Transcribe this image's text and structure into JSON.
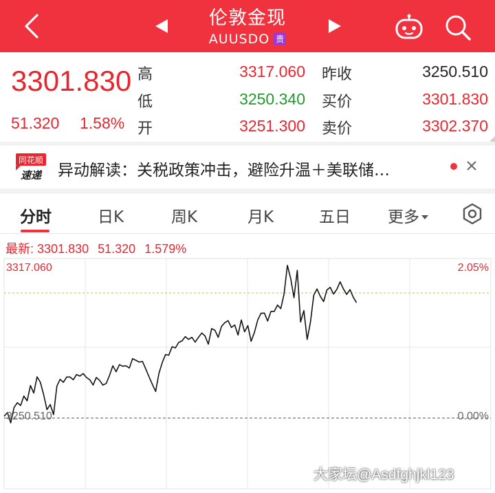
{
  "header": {
    "title": "伦敦金现",
    "subtitle": "AUUSDO",
    "tag": "贵",
    "icons": {
      "back": "back-icon",
      "prev": "triangle-left-icon",
      "next": "triangle-right-icon",
      "assistant": "robot-icon",
      "search": "search-icon"
    }
  },
  "quote": {
    "price": "3301.830",
    "change": "51.320",
    "change_pct": "1.58%",
    "high_label": "高",
    "high": "3317.060",
    "low_label": "低",
    "low": "3250.340",
    "open_label": "开",
    "open": "3251.300",
    "prev_close_label": "昨收",
    "prev_close": "3250.510",
    "bid_label": "买价",
    "bid": "3301.830",
    "ask_label": "卖价",
    "ask": "3302.370"
  },
  "news": {
    "logo_top": "同花顺",
    "logo_bottom": "速递",
    "text": "异动解读：关税政策冲击，避险升温＋美联储…"
  },
  "tabs": [
    {
      "label": "分时",
      "active": true
    },
    {
      "label": "日K"
    },
    {
      "label": "周K"
    },
    {
      "label": "月K"
    },
    {
      "label": "五日"
    },
    {
      "label": "更多"
    }
  ],
  "latest": {
    "label": "最新:",
    "price": "3301.830",
    "change": "51.320",
    "change_pct": "1.579%"
  },
  "colors": {
    "brand_red": "#f0323e",
    "up_red": "#e8262f",
    "down_green": "#1f9a2b",
    "tag_purple": "#9c3ad6"
  },
  "chart_data": {
    "type": "line",
    "ylim": [
      3250.51,
      3317.06
    ],
    "y_tick_labels_left": [
      "3317.060",
      "3250.510"
    ],
    "y_tick_labels_right": [
      "2.05%",
      "0.00%"
    ],
    "reference_line": 3250.51,
    "high_line": 3317.06,
    "series": [
      {
        "values": [
          3251.3,
          3252.9,
          3248.4,
          3255.1,
          3257.2,
          3256.0,
          3260.1,
          3258.0,
          3264.7,
          3261.4,
          3268.5,
          3266.1,
          3260.7,
          3254.2,
          3256.4,
          3252.0,
          3264.4,
          3267.4,
          3266.1,
          3268.4,
          3268.4,
          3267.2,
          3269.5,
          3268.8,
          3269.9,
          3268.2,
          3267.2,
          3264.9,
          3268.2,
          3266.9,
          3264.9,
          3265.6,
          3269.1,
          3273.3,
          3270.7,
          3273.8,
          3273.1,
          3273.3,
          3272.3,
          3276.4,
          3275.7,
          3274.9,
          3275.2,
          3271.9,
          3268.5,
          3265.2,
          3262.1,
          3270.0,
          3274.7,
          3278.2,
          3277.9,
          3281.6,
          3281.1,
          3283.5,
          3284.1,
          3286.0,
          3284.8,
          3285.7,
          3283.6,
          3285.7,
          3287.6,
          3286.3,
          3282.7,
          3289.5,
          3288.8,
          3285.7,
          3290.5,
          3292.1,
          3293.0,
          3290.0,
          3291.1,
          3286.7,
          3293.3,
          3288.1,
          3290.8,
          3284.0,
          3287.9,
          3293.3,
          3296.2,
          3296.3,
          3292.8,
          3297.0,
          3297.0,
          3299.8,
          3298.2,
          3304.6,
          3317.1,
          3311.4,
          3303.0,
          3314.9,
          3292.4,
          3297.4,
          3284.8,
          3292.4,
          3304.1,
          3306.8,
          3303.6,
          3301.3,
          3306.4,
          3307.5,
          3304.6,
          3306.6,
          3309.9,
          3306.8,
          3304.4,
          3306.5,
          3303.2,
          3300.8
        ]
      }
    ]
  },
  "watermark": "大家坛@Asdfghjkl123"
}
